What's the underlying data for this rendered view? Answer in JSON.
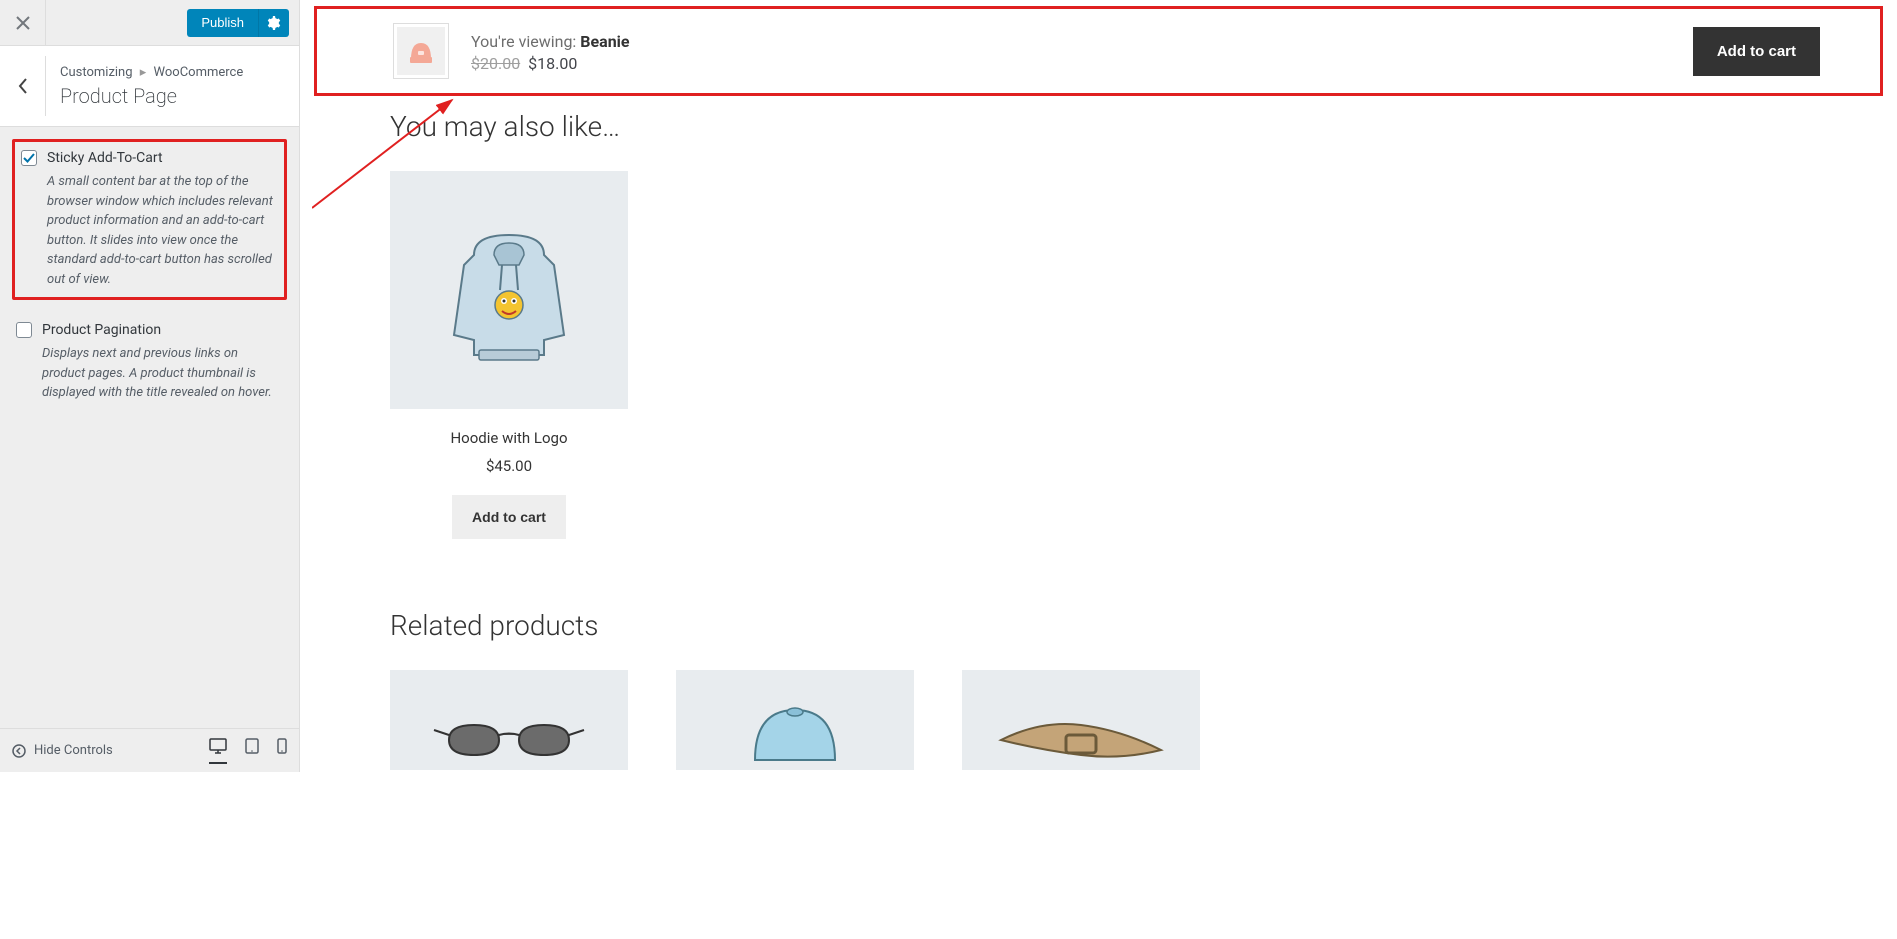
{
  "sidebar": {
    "publish_label": "Publish",
    "breadcrumb_customizing": "Customizing",
    "breadcrumb_section": "WooCommerce",
    "page_title": "Product Page",
    "option1": {
      "label": "Sticky Add-To-Cart",
      "description": "A small content bar at the top of the browser window which includes relevant product information and an add-to-cart button. It slides into view once the standard add-to-cart button has scrolled out of view."
    },
    "option2": {
      "label": "Product Pagination",
      "description": "Displays next and previous links on product pages. A product thumbnail is displayed with the title revealed on hover."
    },
    "hide_controls": "Hide Controls"
  },
  "sticky_bar": {
    "viewing_label": "You're viewing: ",
    "product_name": "Beanie",
    "price_old": "$20.00",
    "price_new": "$18.00",
    "cart_label": "Add to cart"
  },
  "sections": {
    "also_like": "You may also like…",
    "related": "Related products"
  },
  "product1": {
    "name": "Hoodie with Logo",
    "price": "$45.00",
    "cart_label": "Add to cart"
  }
}
